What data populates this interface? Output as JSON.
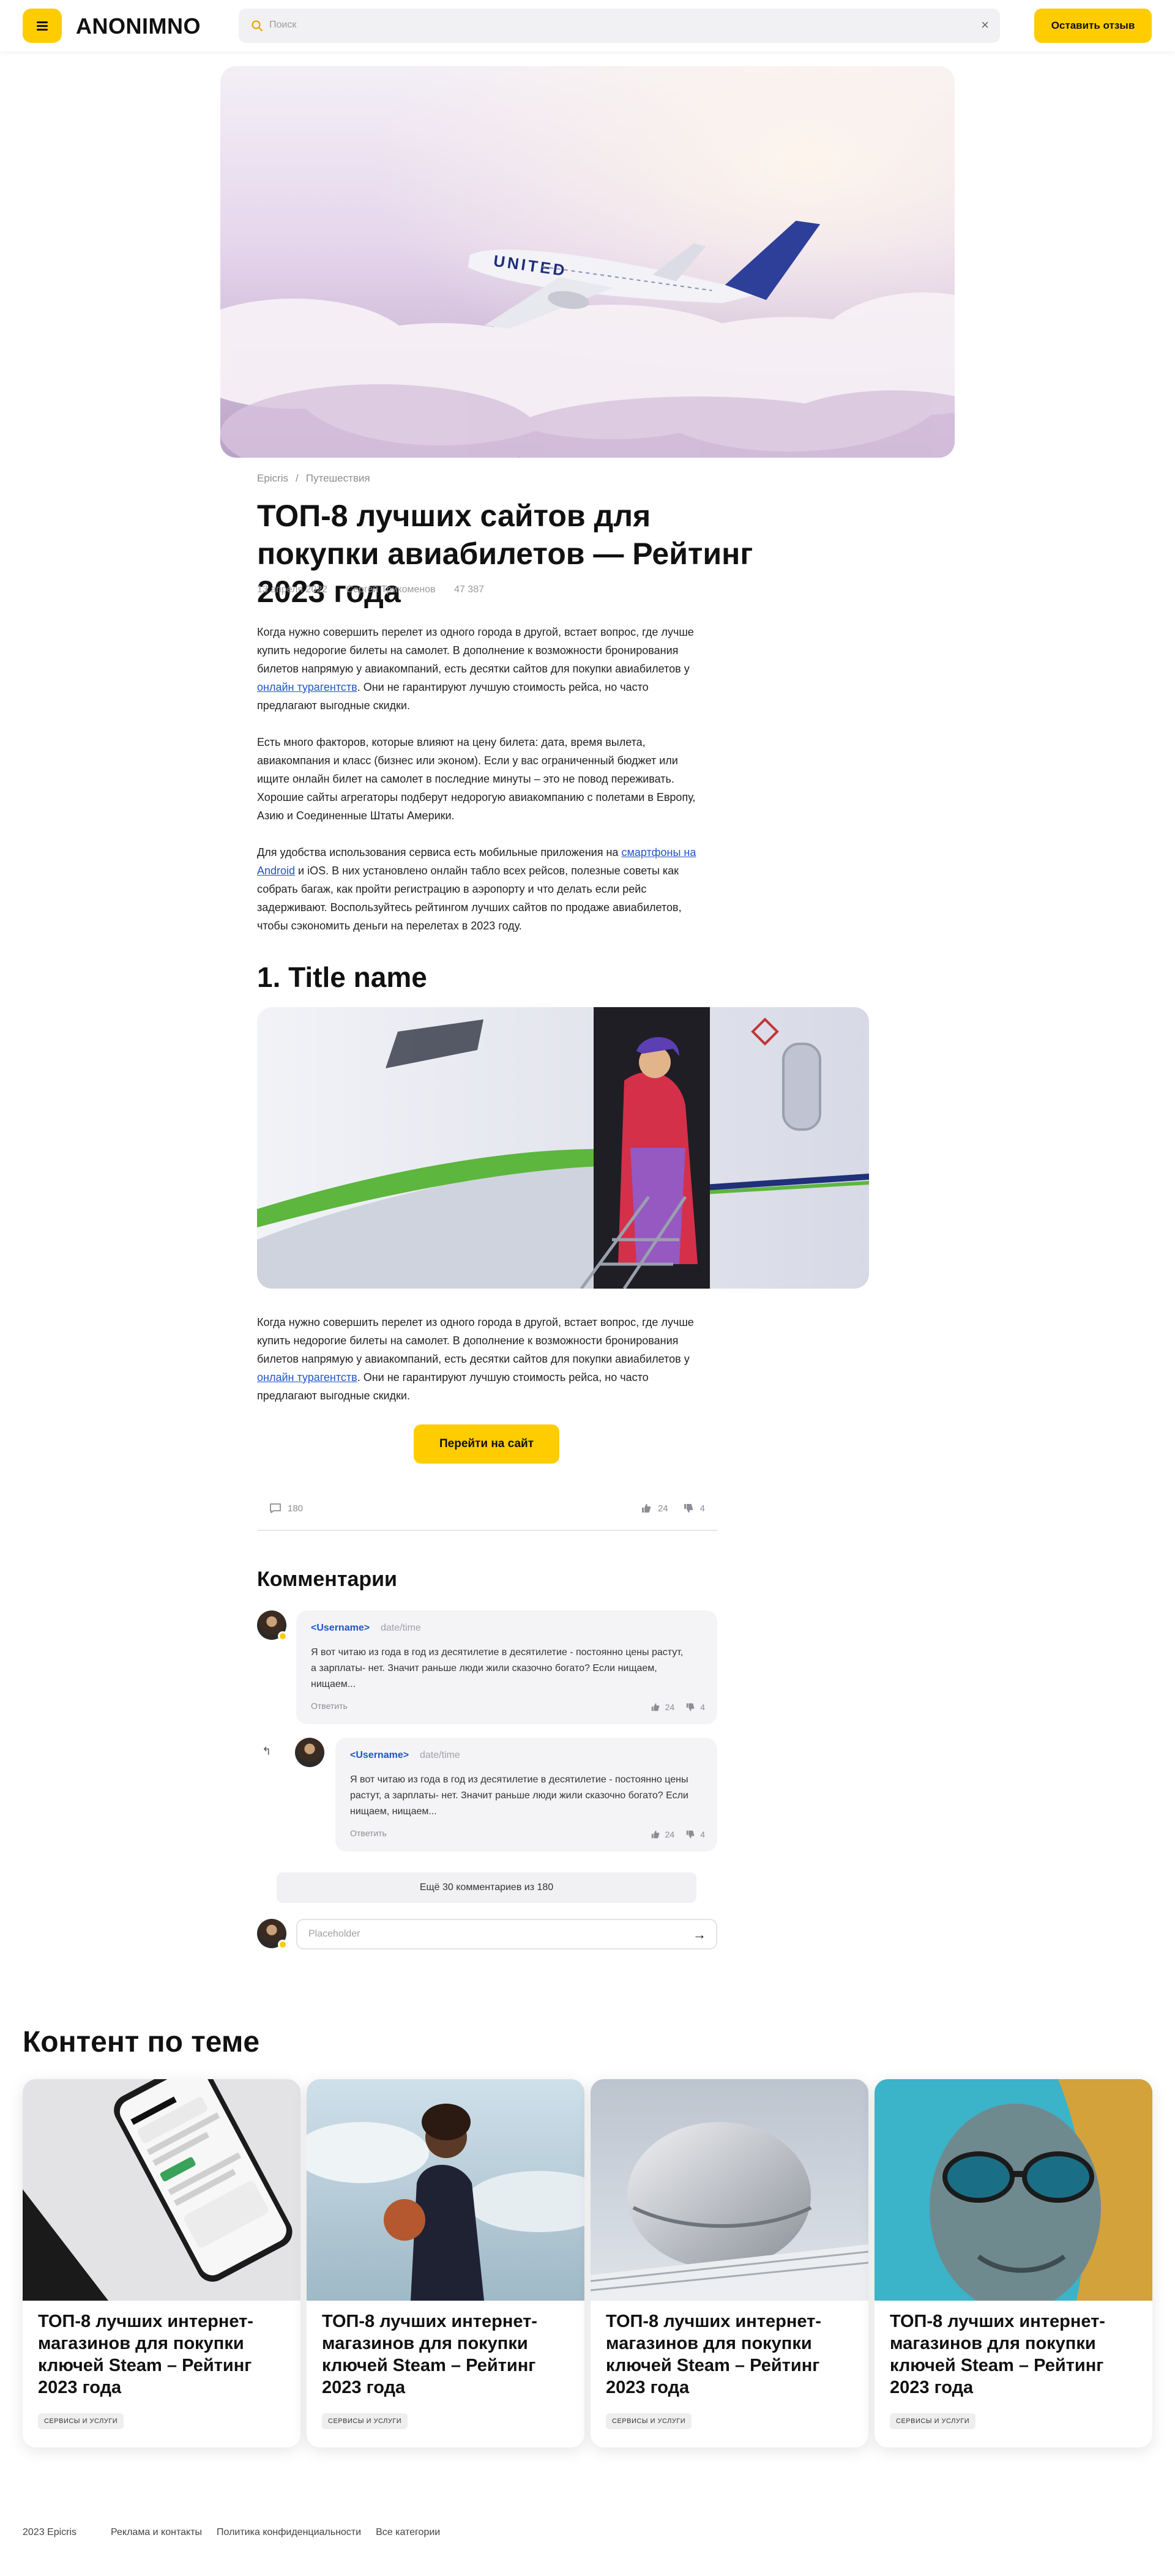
{
  "header": {
    "logo": "ANONIMNO",
    "search_placeholder": "Поиск",
    "cta_label": "Оставить отзыв"
  },
  "article": {
    "breadcrumb": [
      "Epicris",
      "Путешествия"
    ],
    "title": "ТОП-8 лучших сайтов для покупки авиабилетов — Рейтинг 2023 года",
    "meta": {
      "date": "13 апреля 2022",
      "author": "Сергей Трикоменов",
      "views": "47 387"
    },
    "p1_a": "Когда нужно совершить перелет из одного города в другой, встает вопрос, где лучше купить недорогие билеты на самолет. В дополнение к возможности бронирования билетов напрямую у авиакомпаний, есть десятки сайтов для покупки авиабилетов у ",
    "p1_link": "онлайн турагентств",
    "p1_b": ". Они не гарантируют лучшую стоимость рейса, но часто предлагают выгодные скидки.",
    "p2": "Есть много факторов, которые влияют на цену билета: дата, время вылета, авиакомпания и класс (бизнес или эконом). Если у вас ограниченный бюджет или ищите онлайн билет на самолет в последние минуты – это не повод переживать. Хорошие сайты агрегаторы подберут недорогую авиакомпанию с полетами в Европу, Азию и Соединенные Штаты Америки.",
    "p3_a": "Для удобства использования сервиса есть мобильные приложения на ",
    "p3_link": "смартфоны на Android",
    "p3_b": " и iOS. В них установлено онлайн табло всех рейсов, полезные советы как собрать багаж, как пройти регистрацию в аэропорту и что делать если рейс задерживают. Воспользуйтесь рейтингом лучших сайтов по продаже авиабилетов, чтобы сэкономить деньги на перелетах в 2023 году.",
    "section_title": "1. Title name",
    "p4_a": "Когда нужно совершить перелет из одного города в другой, встает вопрос, где лучше купить недорогие билеты на самолет. В дополнение к возможности бронирования билетов напрямую у авиакомпаний, есть десятки сайтов для покупки авиабилетов у ",
    "p4_link": "онлайн турагентств",
    "p4_b": ". Они не гарантируют лучшую стоимость рейса, но часто предлагают выгодные скидки.",
    "go_button": "Перейти на сайт",
    "stats": {
      "comments": "180",
      "likes": "24",
      "dislikes": "4"
    }
  },
  "comments": {
    "title": "Комментарии",
    "items": [
      {
        "user": "<Username>",
        "date": "date/time",
        "text": "Я вот читаю из года в год из десятилетие в десятилетие - постоянно цены растут, а зарплаты- нет. Значит раньше люди жили сказочно богато? Если нищаем, нищаем...",
        "reply": "Ответить",
        "likes": "24",
        "dislikes": "4"
      },
      {
        "user": "<Username>",
        "date": "date/time",
        "text": "Я вот читаю из года в год из десятилетие в десятилетие - постоянно цены растут, а зарплаты- нет. Значит раньше люди жили сказочно богато? Если нищаем, нищаем...",
        "reply": "Ответить",
        "likes": "24",
        "dislikes": "4"
      }
    ],
    "more_label": "Ещё 30 комментариев из 180",
    "input_placeholder": "Placeholder"
  },
  "related": {
    "title": "Контент по теме",
    "cards": [
      {
        "title": "ТОП-8 лучших интернет-магазинов для покупки ключей Steam – Рейтинг 2023 года",
        "tag": "СЕРВИСЫ И УСЛУГИ"
      },
      {
        "title": "ТОП-8 лучших интернет-магазинов для покупки ключей Steam – Рейтинг 2023 года",
        "tag": "СЕРВИСЫ И УСЛУГИ"
      },
      {
        "title": "ТОП-8 лучших интернет-магазинов для покупки ключей Steam – Рейтинг 2023 года",
        "tag": "СЕРВИСЫ И УСЛУГИ"
      },
      {
        "title": "ТОП-8 лучших интернет-магазинов для покупки ключей Steam – Рейтинг 2023 года",
        "tag": "СЕРВИСЫ И УСЛУГИ"
      }
    ]
  },
  "footer": {
    "copyright": "2023 Epicris",
    "links": [
      "Реклама и контакты",
      "Политика конфиденциальности",
      "Все категории"
    ]
  },
  "colors": {
    "accent": "#ffcc00",
    "link": "#2154c8"
  }
}
